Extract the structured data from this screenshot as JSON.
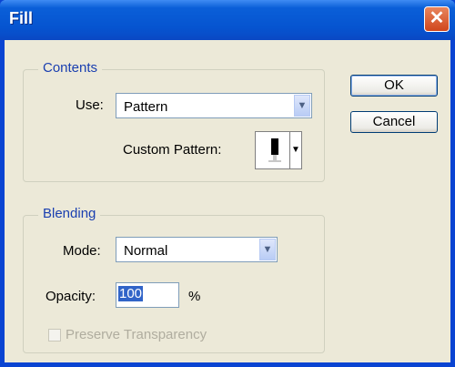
{
  "window": {
    "title": "Fill",
    "close_glyph": "✕"
  },
  "contents": {
    "group_label": "Contents",
    "use_label": "Use:",
    "use_value": "Pattern",
    "custom_pattern_label": "Custom Pattern:"
  },
  "blending": {
    "group_label": "Blending",
    "mode_label": "Mode:",
    "mode_value": "Normal",
    "opacity_label": "Opacity:",
    "opacity_value": "100",
    "opacity_unit": "%",
    "preserve_label": "Preserve Transparency",
    "preserve_checked": false,
    "preserve_enabled": false
  },
  "buttons": {
    "ok": "OK",
    "cancel": "Cancel"
  },
  "icons": {
    "dropdown": "chevron-down-icon",
    "close": "close-icon",
    "pattern": "pattern-swatch-icon"
  }
}
